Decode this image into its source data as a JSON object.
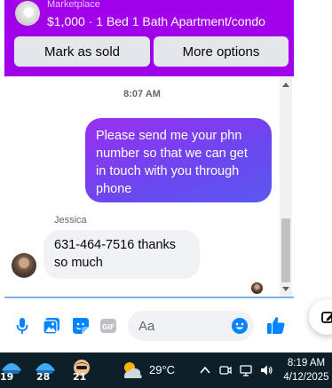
{
  "header": {
    "label": "Marketplace",
    "listing": "$1,000 · 1 Bed 1 Bath Apartment/condo",
    "mark_sold": "Mark as sold",
    "more_options": "More options"
  },
  "chat": {
    "timestamp": "8:07 AM",
    "outgoing_message": "Please send me your phn number so that we can get in touch with you through phone",
    "sender_name": "Jessica",
    "incoming_message": "631-464-7516 thanks so much"
  },
  "composer": {
    "placeholder": "Aa",
    "icons": [
      "microphone-icon",
      "image-icon",
      "sticker-icon",
      "gif-icon",
      "emoji-icon",
      "thumbs-up-icon"
    ]
  },
  "taskbar": {
    "apps": [
      {
        "badge": "19"
      },
      {
        "badge": "28"
      },
      {
        "badge": "21"
      }
    ],
    "temperature": "29°C",
    "time": "8:19 AM",
    "date": "4/12/2025"
  },
  "colors": {
    "header": "#a100ea",
    "accent": "#0084ff",
    "bubble_out_start": "#9a2ff0",
    "bubble_out_end": "#5b57ef",
    "taskbar": "#0d1f29"
  }
}
